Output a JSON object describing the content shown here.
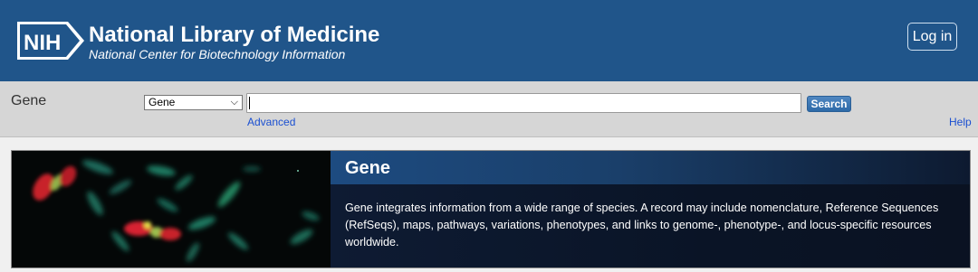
{
  "header": {
    "logo_text": "NIH",
    "title": "National Library of Medicine",
    "subtitle": "National Center for Biotechnology Information",
    "login_label": "Log in",
    "background_color": "#20558a"
  },
  "searchbar": {
    "database_title": "Gene",
    "database_select": {
      "selected": "Gene"
    },
    "search_value": "",
    "search_button_label": "Search",
    "advanced_label": "Advanced",
    "help_label": "Help"
  },
  "banner": {
    "title": "Gene",
    "description": "Gene integrates information from a wide range of species. A record may include nomenclature, Reference Sequences (RefSeqs), maps, pathways, variations, phenotypes, and links to genome-, phenotype-, and locus-specific resources worldwide.",
    "image": "chromosome-fluorescence-image"
  }
}
